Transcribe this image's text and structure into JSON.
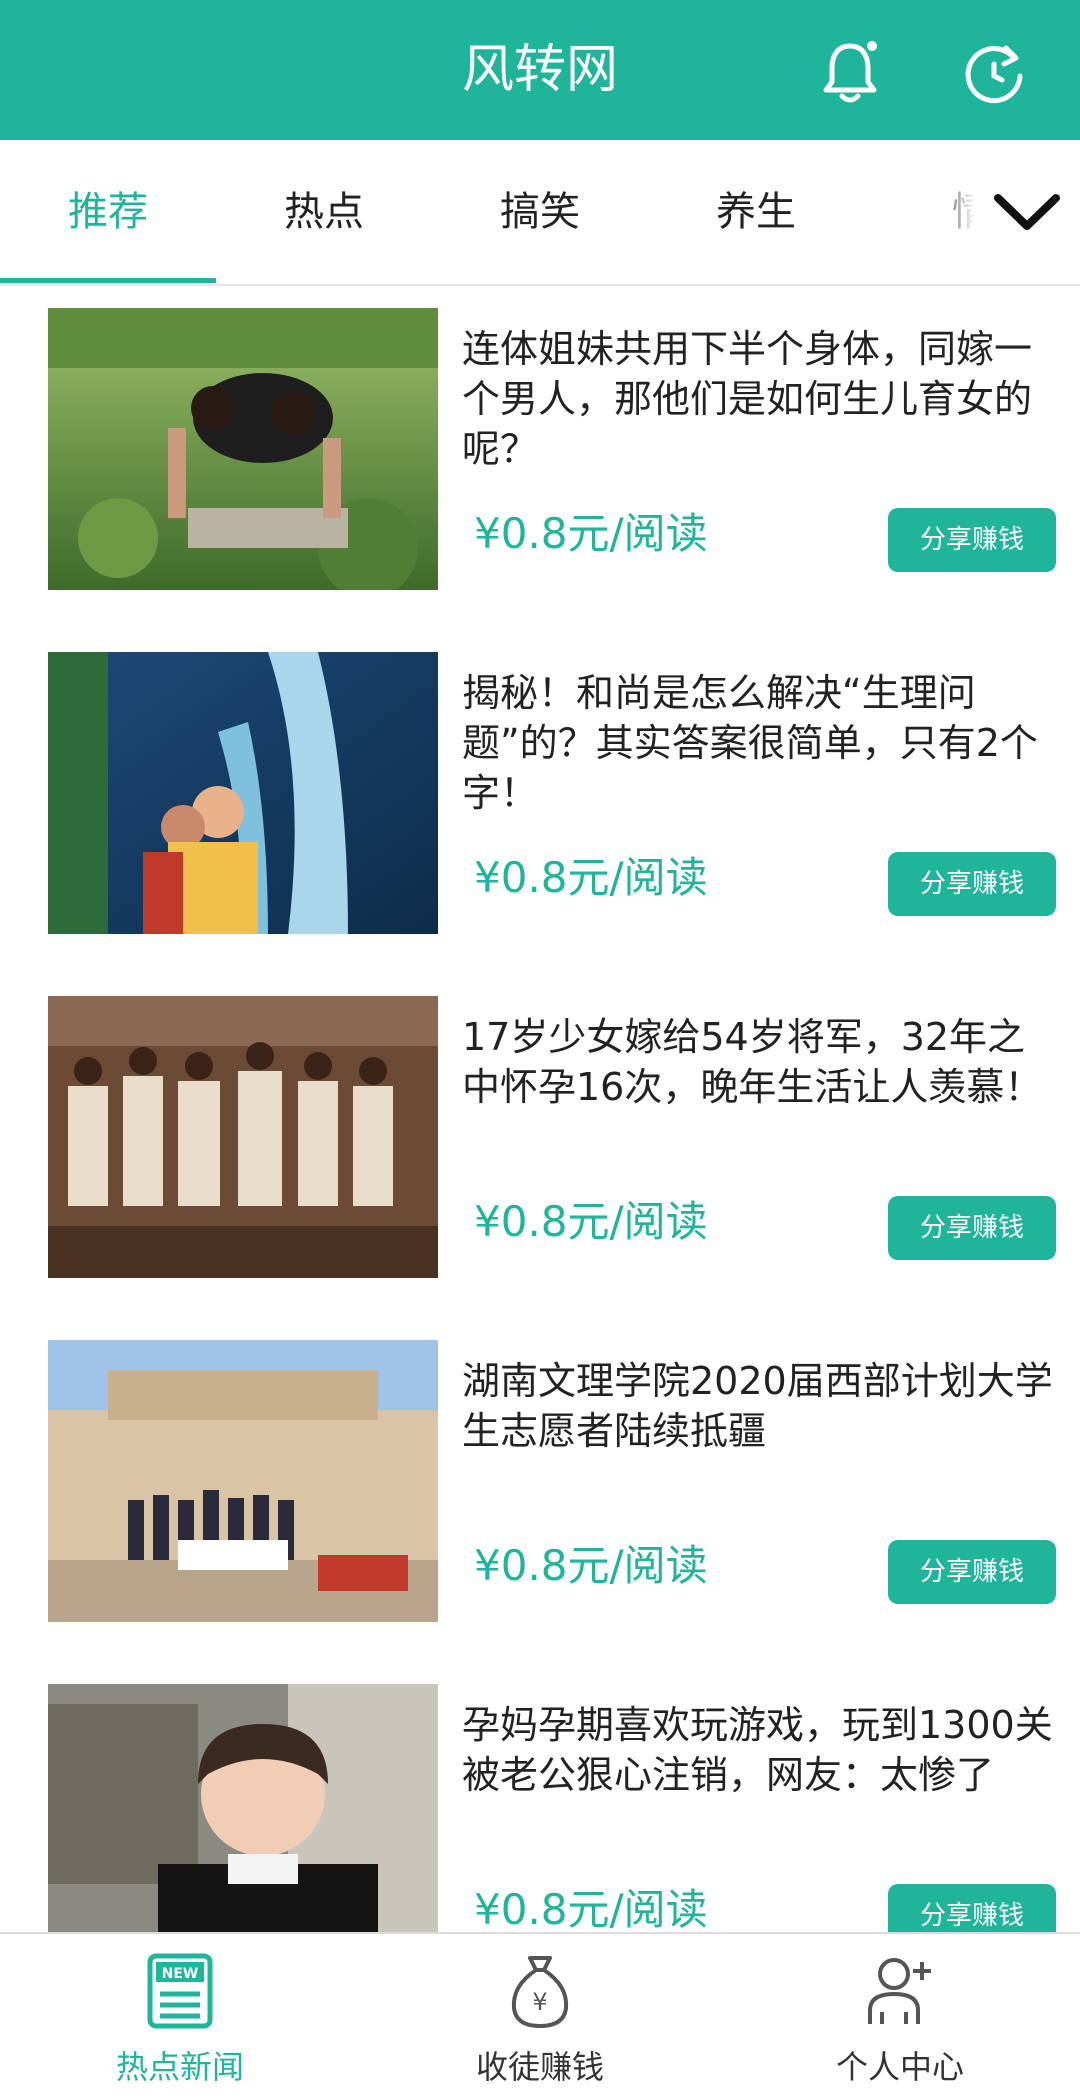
{
  "header": {
    "title": "风转网",
    "bell_icon": "bell-icon",
    "refresh_icon": "refresh-icon"
  },
  "tabs": [
    {
      "label": "推荐",
      "active": true
    },
    {
      "label": "热点",
      "active": false
    },
    {
      "label": "搞笑",
      "active": false
    },
    {
      "label": "养生",
      "active": false
    },
    {
      "label": "情",
      "active": false
    }
  ],
  "tabs_more_icon": "chevron-down-icon",
  "articles": [
    {
      "title": "连体姐妹共用下半个身体，同嫁一个男人，那他们是如何生儿育女的呢？",
      "price": "¥0.8元/阅读",
      "share_label": "分享赚钱"
    },
    {
      "title": "揭秘！和尚是怎么解决“生理问题”的？其实答案很简单，只有2个字！",
      "price": "¥0.8元/阅读",
      "share_label": "分享赚钱"
    },
    {
      "title": "17岁少女嫁给54岁将军，32年之中怀孕16次，晚年生活让人羡慕！",
      "price": "¥0.8元/阅读",
      "share_label": "分享赚钱"
    },
    {
      "title": "湖南文理学院2020届西部计划大学生志愿者陆续抵疆",
      "price": "¥0.8元/阅读",
      "share_label": "分享赚钱"
    },
    {
      "title": "孕妈孕期喜欢玩游戏，玩到1300关被老公狠心注销，网友：太惨了",
      "price": "¥0.8元/阅读",
      "share_label": "分享赚钱"
    }
  ],
  "bottom_nav": [
    {
      "label": "热点新闻",
      "icon": "news-icon",
      "active": true
    },
    {
      "label": "收徒赚钱",
      "icon": "money-bag-icon",
      "active": false
    },
    {
      "label": "个人中心",
      "icon": "user-add-icon",
      "active": false
    }
  ],
  "colors": {
    "accent": "#1fb59a",
    "text": "#222222",
    "divider": "#e6e6e6"
  }
}
